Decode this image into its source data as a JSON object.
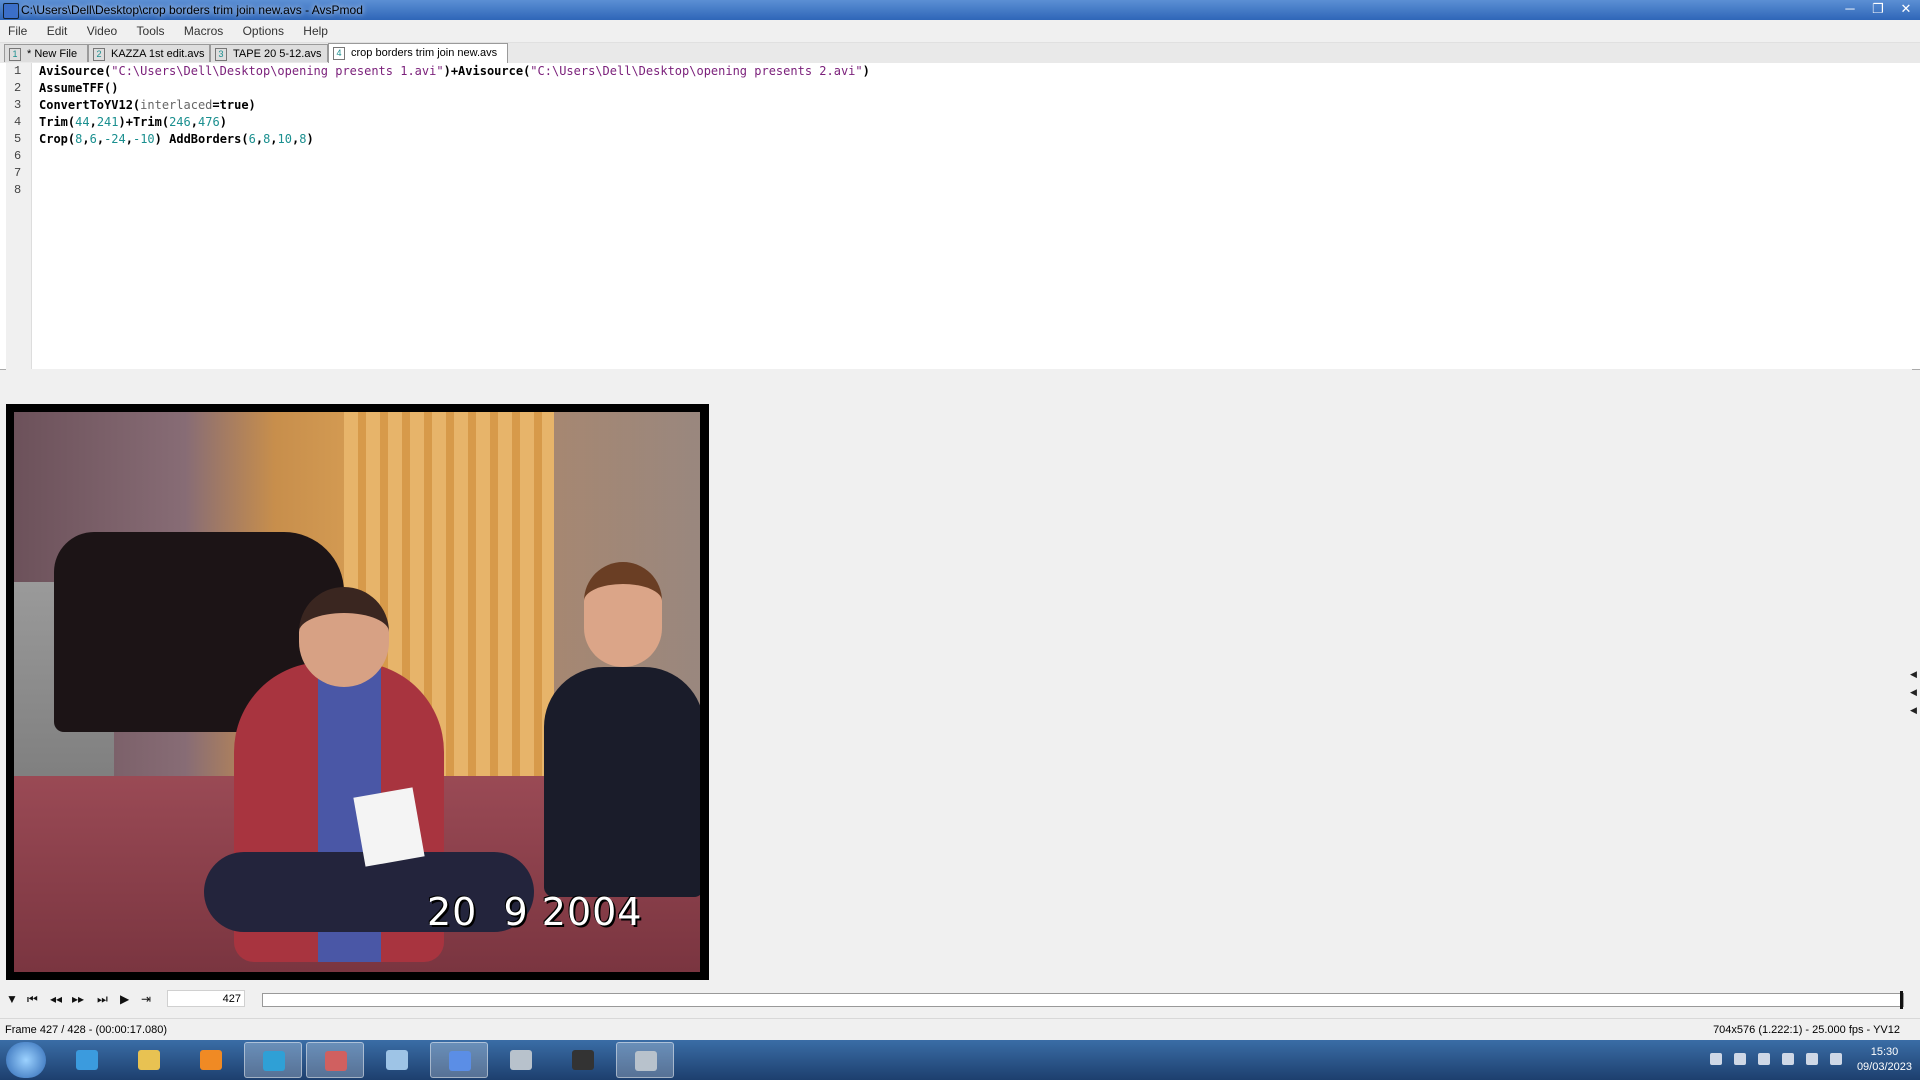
{
  "window": {
    "title": "C:\\Users\\Dell\\Desktop\\crop borders trim join new.avs - AvsPmod",
    "controls": [
      "─",
      "❐",
      "✕"
    ]
  },
  "menu": [
    "File",
    "Edit",
    "Video",
    "Tools",
    "Macros",
    "Options",
    "Help"
  ],
  "tabs": [
    {
      "num": "1",
      "label": "* New File"
    },
    {
      "num": "2",
      "label": "KAZZA 1st edit.avs"
    },
    {
      "num": "3",
      "label": "TAPE 20 5-12.avs"
    },
    {
      "num": "4",
      "label": "crop borders trim join new.avs",
      "active": true
    }
  ],
  "editor": {
    "line_numbers": [
      "1",
      "2",
      "3",
      "4",
      "5",
      "6",
      "7",
      "8"
    ],
    "lines": [
      [
        [
          "kw",
          "AviSource("
        ],
        [
          "str",
          "\"C:\\Users\\Dell\\Desktop\\opening presents 1.avi\""
        ],
        [
          "kw",
          ")+Avisource("
        ],
        [
          "str",
          "\"C:\\Users\\Dell\\Desktop\\opening presents 2.avi\""
        ],
        [
          "kw",
          ")"
        ]
      ],
      [
        [
          "kw",
          "AssumeTFF()"
        ]
      ],
      [
        [
          "kw",
          "ConvertToYV12("
        ],
        [
          "param",
          "interlaced"
        ],
        [
          "kw",
          "="
        ],
        [
          "bool",
          "true"
        ],
        [
          "kw",
          ")"
        ]
      ],
      [
        [
          "kw",
          "Trim("
        ],
        [
          "num",
          "44"
        ],
        [
          "kw",
          ","
        ],
        [
          "num",
          "241"
        ],
        [
          "kw",
          ")+Trim("
        ],
        [
          "num",
          "246"
        ],
        [
          "kw",
          ","
        ],
        [
          "num",
          "476"
        ],
        [
          "kw",
          ")"
        ]
      ],
      [
        [
          "kw",
          "Crop("
        ],
        [
          "num",
          "8"
        ],
        [
          "kw",
          ","
        ],
        [
          "num",
          "6"
        ],
        [
          "kw",
          ","
        ],
        [
          "num",
          "-24"
        ],
        [
          "kw",
          ","
        ],
        [
          "num",
          "-10"
        ],
        [
          "kw",
          ") AddBorders("
        ],
        [
          "num",
          "6"
        ],
        [
          "kw",
          ","
        ],
        [
          "num",
          "8"
        ],
        [
          "kw",
          ","
        ],
        [
          "num",
          "10"
        ],
        [
          "kw",
          ","
        ],
        [
          "num",
          "8"
        ],
        [
          "kw",
          ")"
        ]
      ],
      [],
      [],
      []
    ]
  },
  "preview": {
    "osd_date": "20  9 2004"
  },
  "transport": {
    "frame_input": "427",
    "position_fraction": 0.998
  },
  "status": {
    "left": "Frame 427 / 428  -  (00:00:17.080)",
    "right": "704x576 (1.222:1)  -  25.000 fps  -  YV12"
  },
  "taskbar": {
    "time": "15:30",
    "date": "09/03/2023",
    "apps": [
      {
        "name": "internet-explorer-icon",
        "color": "#3b9bde"
      },
      {
        "name": "file-explorer-icon",
        "color": "#e8c252"
      },
      {
        "name": "media-player-icon",
        "color": "#f08a24"
      },
      {
        "name": "edge-icon",
        "color": "#2fa0d6",
        "active": true
      },
      {
        "name": "paint-icon",
        "color": "#d06060",
        "active": true
      },
      {
        "name": "notepad-icon",
        "color": "#9ec4e6"
      },
      {
        "name": "avspmod-icon",
        "color": "#5b8ee6",
        "active": true
      },
      {
        "name": "settings-gear-icon",
        "color": "#b8c2cc"
      },
      {
        "name": "video-clapper-icon",
        "color": "#333333"
      },
      {
        "name": "settings-gear-icon",
        "color": "#b8c2cc",
        "active": true
      }
    ]
  }
}
